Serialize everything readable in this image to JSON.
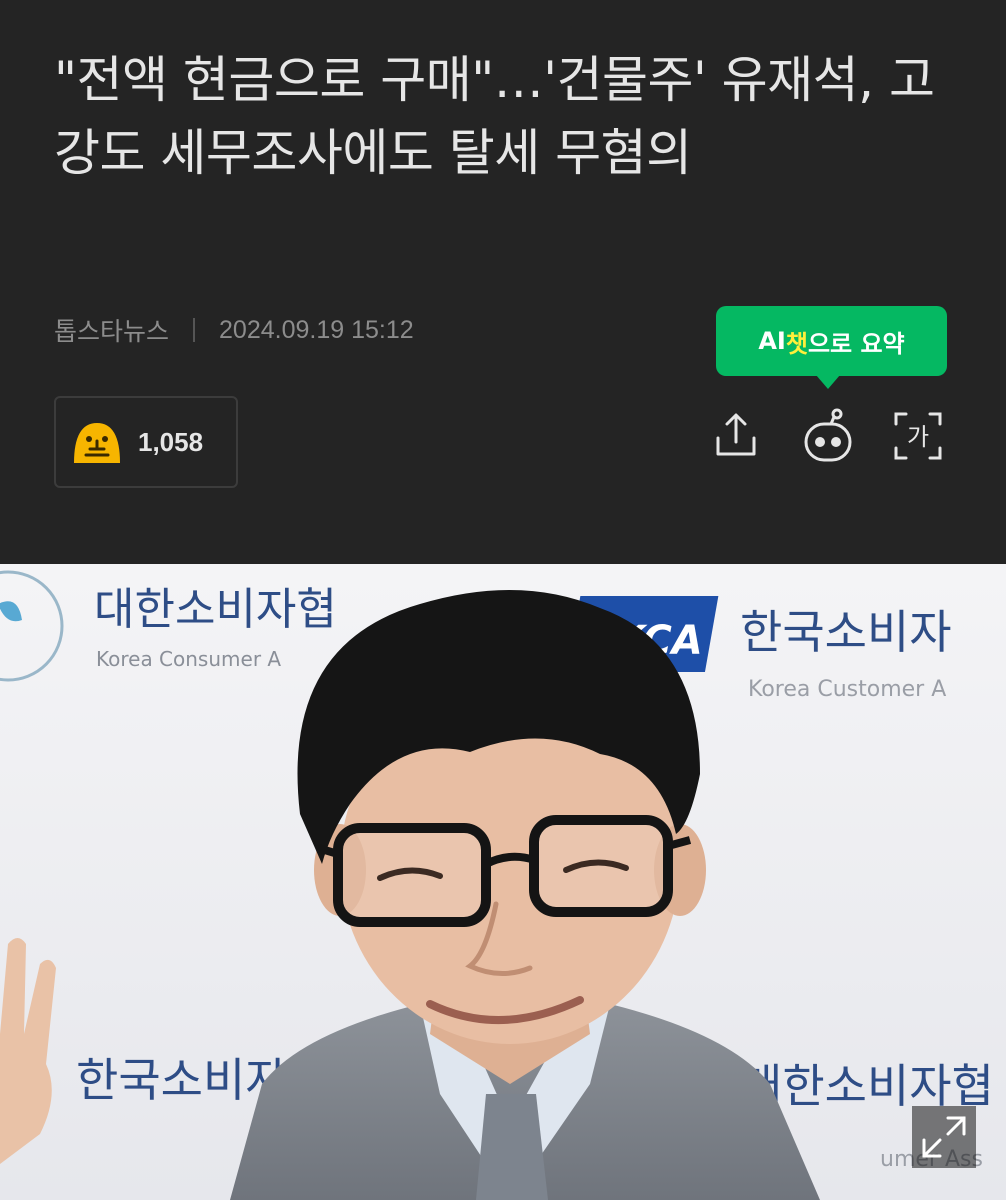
{
  "article": {
    "headline": "\"전액 현금으로 구매\"…'건물주' 유재석, 고강도 세무조사에도 탈세 무혐의",
    "source": "톱스타뉴스",
    "datetime": "2024.09.19 15:12"
  },
  "ai_summary": {
    "prefix": "AI",
    "highlight": "챗",
    "suffix": "으로 요약",
    "color": "#05b862",
    "highlight_color": "#ffef3b"
  },
  "reaction": {
    "count": "1,058",
    "icon": "face-emoji-icon"
  },
  "toolbar": {
    "icons": [
      "share-icon",
      "ai-bot-icon",
      "font-size-icon"
    ],
    "font_glyph": "가"
  },
  "photo": {
    "backdrop_texts": {
      "left_korean": "대한소비자협",
      "left_english": "Korea Consumer A",
      "right_korean": "한국소비자",
      "right_english": "Korea Customer A",
      "logo": "KCA",
      "bottom_left": "한국소비자",
      "bottom_right": "대한소비자협",
      "bottom_right_english": "umer Ass"
    },
    "expand_icon": "expand-icon"
  }
}
